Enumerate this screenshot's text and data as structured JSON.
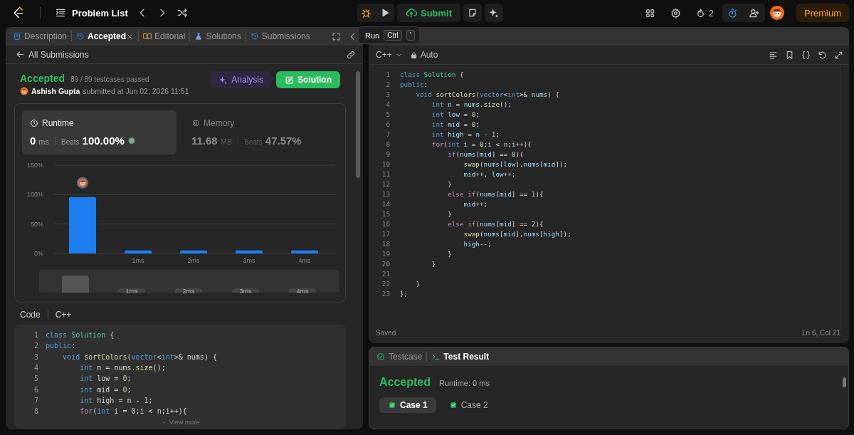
{
  "topbar": {
    "title": "Problem List",
    "submit": "Submit",
    "streak": "2",
    "premium": "Premium"
  },
  "tooltip": {
    "label": "Run",
    "keys": [
      "Ctrl",
      "'"
    ]
  },
  "left_tabs": [
    {
      "label": "Description",
      "kind": "document",
      "selected": false,
      "closable": false
    },
    {
      "label": "Accepted",
      "kind": "history",
      "selected": true,
      "closable": true
    },
    {
      "label": "Editorial",
      "kind": "book",
      "selected": false,
      "closable": false
    },
    {
      "label": "Solutions",
      "kind": "flask",
      "selected": false,
      "closable": false
    },
    {
      "label": "Submissions",
      "kind": "history",
      "selected": false,
      "closable": false
    }
  ],
  "submission": {
    "back": "All Submissions",
    "status": "Accepted",
    "passed": "89 / 89 testcases passed",
    "author": "Ashish Gupta",
    "submitted": "submitted at Jun 02, 2026 11:51",
    "analysis": "Analysis",
    "solution": "Solution"
  },
  "stats": [
    {
      "kind": "runtime",
      "label": "Runtime",
      "value": "0",
      "unit": "ms",
      "beats_label": "Beats",
      "beats": "100.00%",
      "selected": true
    },
    {
      "kind": "memory",
      "label": "Memory",
      "value": "11.68",
      "unit": "MB",
      "beats_label": "Beats",
      "beats": "47.57%",
      "selected": false
    }
  ],
  "chart_data": {
    "type": "bar",
    "categories": [
      null,
      "1ms",
      "2ms",
      "3ms",
      "4ms"
    ],
    "values": [
      96,
      5,
      5,
      5,
      5
    ],
    "ylim": [
      0,
      150
    ],
    "yticks": [
      {
        "value": 0,
        "label": "0%"
      },
      {
        "value": 50,
        "label": "50%"
      },
      {
        "value": 100,
        "label": "100%"
      },
      {
        "value": 150,
        "label": "150%"
      }
    ]
  },
  "overview_labels": [
    "1ms",
    "2ms",
    "3ms",
    "4ms"
  ],
  "code_header": {
    "label": "Code",
    "language": "C++"
  },
  "code_preview": [
    {
      "no": "1",
      "code": "class Solution {"
    },
    {
      "no": "2",
      "code": "public:"
    },
    {
      "no": "3",
      "code": "    void sortColors(vector<int>& nums) {"
    },
    {
      "no": "4",
      "code": "        int n = nums.size();"
    },
    {
      "no": "5",
      "code": "        int low = 0;"
    },
    {
      "no": "6",
      "code": "        int mid = 0;"
    },
    {
      "no": "7",
      "code": "        int high = n - 1;"
    },
    {
      "no": "8",
      "code": "        for(int i = 0;i < n;i++){"
    }
  ],
  "view_more": "View more",
  "editor": {
    "language": "C++",
    "mode": "Auto",
    "lines": [
      {
        "no": "1",
        "code": "class Solution {"
      },
      {
        "no": "2",
        "code": "public:"
      },
      {
        "no": "3",
        "code": "    void sortColors(vector<int>& nums) {"
      },
      {
        "no": "4",
        "code": "        int n = nums.size();"
      },
      {
        "no": "5",
        "code": "        int low = 0;"
      },
      {
        "no": "6",
        "code": "        int mid = 0;"
      },
      {
        "no": "7",
        "code": "        int high = n - 1;"
      },
      {
        "no": "8",
        "code": "        for(int i = 0;i < n;i++){"
      },
      {
        "no": "9",
        "code": "            if(nums[mid] == 0){"
      },
      {
        "no": "10",
        "code": "                swap(nums[low],nums[mid]);"
      },
      {
        "no": "11",
        "code": "                mid++, low++;"
      },
      {
        "no": "12",
        "code": "            }"
      },
      {
        "no": "13",
        "code": "            else if(nums[mid] == 1){"
      },
      {
        "no": "14",
        "code": "                mid++;"
      },
      {
        "no": "15",
        "code": "            }"
      },
      {
        "no": "16",
        "code": "            else if(nums[mid] == 2){"
      },
      {
        "no": "17",
        "code": "                swap(nums[mid],nums[high]);"
      },
      {
        "no": "18",
        "code": "                high--;"
      },
      {
        "no": "19",
        "code": "            }"
      },
      {
        "no": "20",
        "code": "        }"
      },
      {
        "no": "21"
      },
      {
        "no": "22",
        "code": "    }"
      },
      {
        "no": "23",
        "code": "};"
      }
    ],
    "status": "Saved",
    "cursor": "Ln 6, Col 21"
  },
  "test_panel": {
    "tabs": [
      {
        "label": "Testcase",
        "kind": "checkbox",
        "selected": false
      },
      {
        "label": "Test Result",
        "kind": "terminal",
        "selected": true
      }
    ],
    "status": "Accepted",
    "runtime": "Runtime: 0 ms",
    "cases": [
      {
        "label": "Case 1",
        "selected": true
      },
      {
        "label": "Case 2",
        "selected": false
      }
    ]
  }
}
